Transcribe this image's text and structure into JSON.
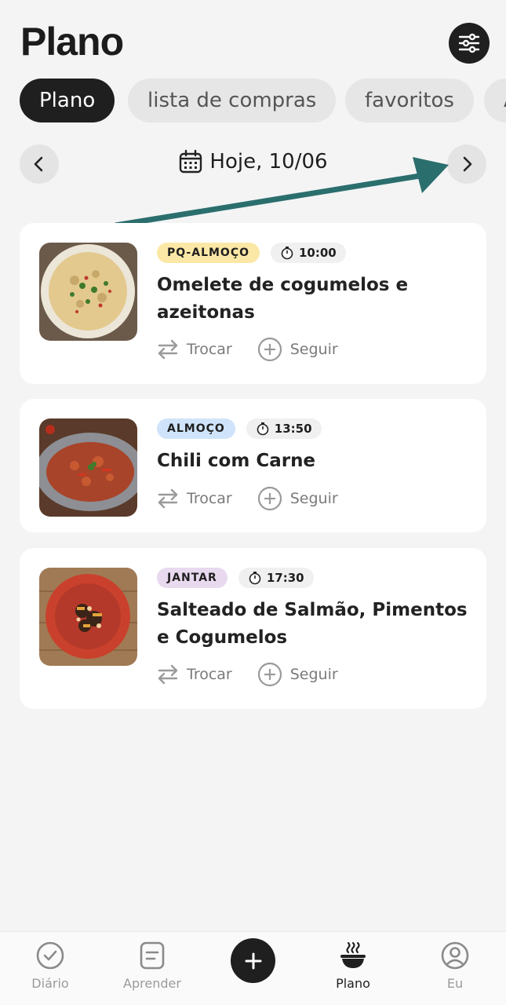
{
  "header": {
    "title": "Plano"
  },
  "tabs": [
    {
      "label": "Plano"
    },
    {
      "label": "lista de compras"
    },
    {
      "label": "favoritos"
    },
    {
      "label": "A"
    }
  ],
  "date_nav": {
    "label": "Hoje, 10/06"
  },
  "meals": [
    {
      "badge": "PQ-ALMOÇO",
      "badge_color": "#fbe8a6",
      "time": "10:00",
      "title": "Omelete de cogumelos e azeitonas",
      "swap_label": "Trocar",
      "follow_label": "Seguir"
    },
    {
      "badge": "ALMOÇO",
      "badge_color": "#cfe4fb",
      "time": "13:50",
      "title": "Chili com Carne",
      "swap_label": "Trocar",
      "follow_label": "Seguir"
    },
    {
      "badge": "JANTAR",
      "badge_color": "#e8d9ef",
      "time": "17:30",
      "title": "Salteado de Salmão, Pimentos e Cogumelos",
      "swap_label": "Trocar",
      "follow_label": "Seguir"
    }
  ],
  "bottom_nav": [
    {
      "label": "Diário",
      "icon": "check-circle-icon"
    },
    {
      "label": "Aprender",
      "icon": "notes-icon"
    },
    {
      "label": "Plano",
      "icon": "bowl-icon"
    },
    {
      "label": "Eu",
      "icon": "profile-icon"
    }
  ],
  "colors": {
    "accent_dark": "#1f1f1f",
    "annotation_arrow": "#2b6e6e"
  }
}
